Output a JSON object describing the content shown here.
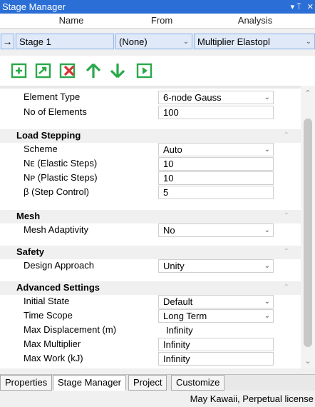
{
  "window": {
    "title": "Stage Manager",
    "pin": "▾ ⍑",
    "close": "✕"
  },
  "columns": {
    "name": "Name",
    "from": "From",
    "analysis": "Analysis"
  },
  "stage_row": {
    "arrow": "→",
    "name": "Stage 1",
    "from": "(None)",
    "analysis": "Multiplier Elastopl"
  },
  "toolbar": [
    "add-stage",
    "add-child-stage",
    "delete-stage",
    "move-up",
    "move-down",
    "run"
  ],
  "properties": {
    "element_type": {
      "label": "Element Type",
      "value": "6-node Gauss"
    },
    "no_elements": {
      "label": "No of Elements",
      "value": "100"
    },
    "load_stepping": {
      "title": "Load Stepping",
      "scheme": {
        "label": "Scheme",
        "value": "Auto"
      },
      "ne_label": "Nᴇ (Elastic Steps)",
      "ne_value": "10",
      "np_label": "Nᴘ (Plastic Steps)",
      "np_value": "10",
      "beta_label": "β (Step Control)",
      "beta_value": "5"
    },
    "mesh": {
      "title": "Mesh",
      "label": "Mesh Adaptivity",
      "value": "No"
    },
    "safety": {
      "title": "Safety",
      "label": "Design Approach",
      "value": "Unity"
    },
    "advanced": {
      "title": "Advanced Settings",
      "initial_state": {
        "label": "Initial State",
        "value": "Default"
      },
      "time_scope": {
        "label": "Time Scope",
        "value": "Long Term"
      },
      "max_disp": {
        "label": "Max Displacement (m)",
        "value": "Infinity"
      },
      "max_mult": {
        "label": "Max Multiplier",
        "value": "Infinity"
      },
      "max_work": {
        "label": "Max Work (kJ)",
        "value": "Infinity"
      }
    }
  },
  "tabs": [
    "Properties",
    "Stage Manager",
    "Project",
    "Customize"
  ],
  "status": "May Kawaii, Perpetual license",
  "colors": {
    "titlebar": "#2b6fd6",
    "green": "#2aa84a",
    "red": "#d63232"
  }
}
